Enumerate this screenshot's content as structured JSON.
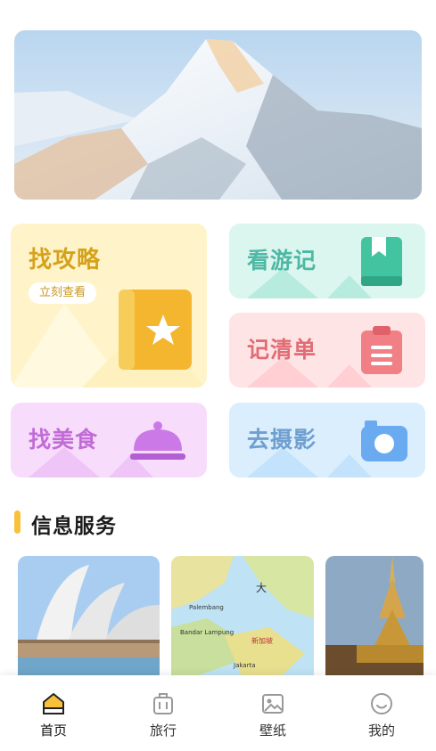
{
  "banner": {
    "alt": "snow mountain"
  },
  "cards": {
    "guide": {
      "title": "找攻略",
      "button": "立刻查看",
      "icon": "star-book-icon",
      "color": "#f3b62e"
    },
    "travel_notes": {
      "title": "看游记",
      "icon": "bookmark-book-icon",
      "color": "#4cc9a6"
    },
    "checklist": {
      "title": "记清单",
      "icon": "clipboard-icon",
      "color": "#f07f86"
    },
    "food": {
      "title": "找美食",
      "icon": "dish-cloche-icon",
      "color": "#cc79e8"
    },
    "photo": {
      "title": "去摄影",
      "icon": "camera-icon",
      "color": "#6aaaf0"
    }
  },
  "section": {
    "title": "信息服务"
  },
  "thumbs": [
    {
      "name": "opera-house-image"
    },
    {
      "name": "map-image",
      "labels": [
        "大",
        "新加坡",
        "Bandar Lampung",
        "Palembang",
        "Jakarta"
      ]
    },
    {
      "name": "pagoda-image"
    }
  ],
  "tabbar": {
    "items": [
      {
        "label": "首页",
        "icon": "home-icon",
        "active": true
      },
      {
        "label": "旅行",
        "icon": "suitcase-icon",
        "active": false
      },
      {
        "label": "壁纸",
        "icon": "picture-icon",
        "active": false
      },
      {
        "label": "我的",
        "icon": "smile-icon",
        "active": false
      }
    ]
  }
}
